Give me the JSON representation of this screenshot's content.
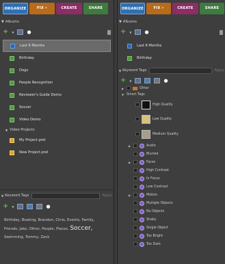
{
  "left_panel": {
    "tabs": {
      "organize": "ORGANIZE",
      "fix": "FIX",
      "create": "CREATE",
      "share": "SHARE"
    },
    "albums_header": "Albums",
    "albums": [
      "Last 6 Months",
      "Birthday",
      "Dogs",
      "People Recognition",
      "Reviewer's Guide Demo",
      "Soccer",
      "Video Demo"
    ],
    "video_projects_label": "Video Projects",
    "projects": [
      "My Project.prel",
      "New Project.prel"
    ],
    "keyword_tags_header": "Keyword Tags",
    "apply_label": "Apply",
    "tag_cloud_prefix": "Birthday, Boating, Brandon, Chris, Events, Family, Friends, Jake, Other, People, Places,",
    "tag_cloud_big": "Soccer,",
    "tag_cloud_suffix": "Swimming, Tommy, Zack"
  },
  "right_panel": {
    "tabs": {
      "organize": "ORGANIZE",
      "fix": "FIX",
      "create": "CREATE",
      "share": "SHARE"
    },
    "albums_header": "Albums",
    "albums": [
      "Last 6 Months",
      "Birthday"
    ],
    "keyword_tags_header": "Keyword Tags",
    "apply_label": "Apply",
    "other_label": "Other",
    "smart_tags_label": "Smart Tags",
    "quality_tags": [
      "High Quality",
      "Low Quality",
      "Medium Quality"
    ],
    "smart_tags": [
      "Audio",
      "Blurred",
      "Faces",
      "High Contrast",
      "In Focus",
      "Low Contrast",
      "Motion",
      "Multiple Objects",
      "No Objects",
      "Shaky",
      "Single Object",
      "Too Bright",
      "Too Dark"
    ]
  }
}
